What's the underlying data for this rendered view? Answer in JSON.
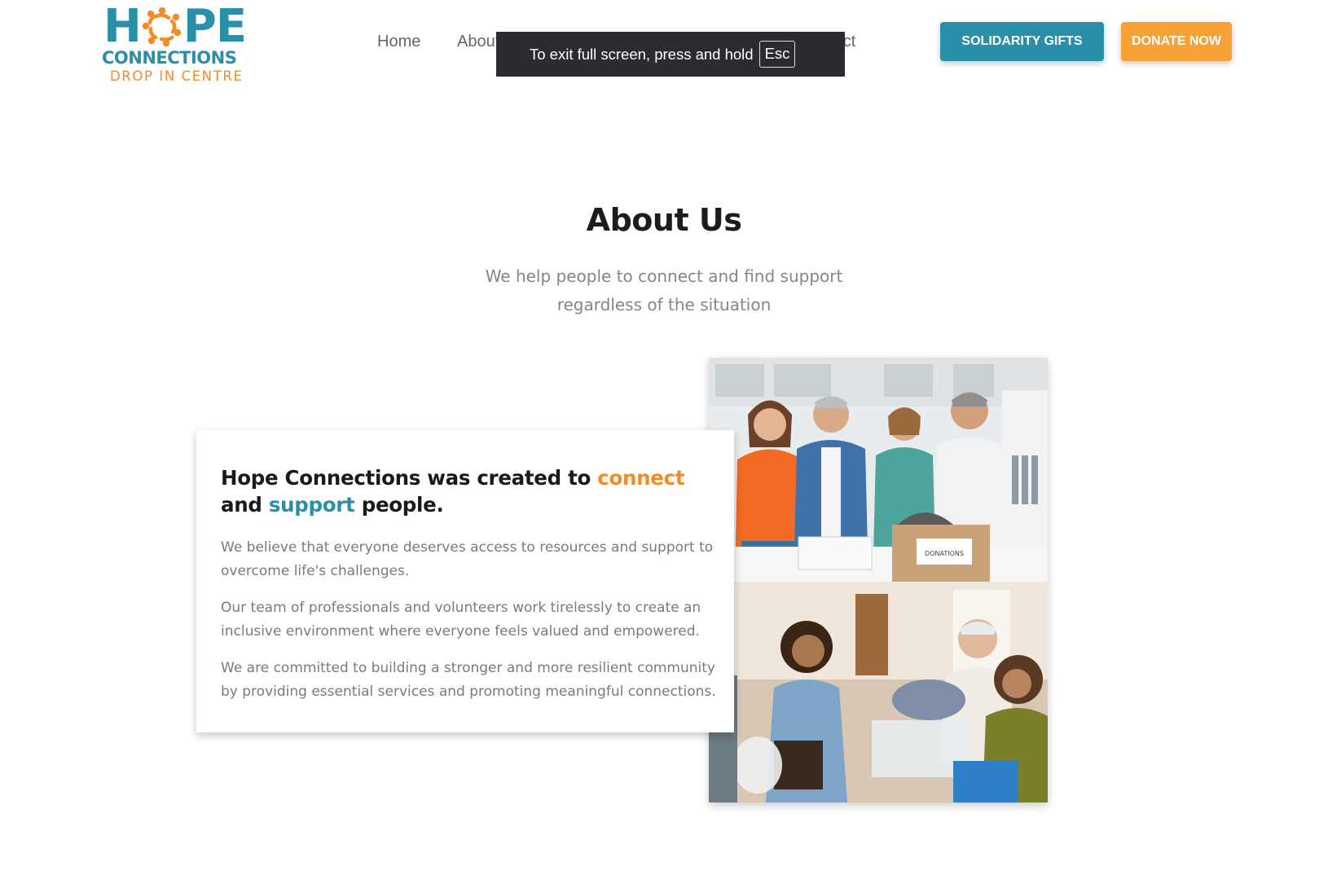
{
  "header": {
    "logo": {
      "hope_h": "H",
      "hope_pe": "PE",
      "connections": "CONNECTIONS",
      "drop_in": "DROP IN CENTRE"
    },
    "nav": {
      "home": "Home",
      "about": "About",
      "contact": "ntact"
    },
    "solidarity_label": "SOLIDARITY GIFTS",
    "donate_label": "DONATE NOW"
  },
  "fullscreen_notice": {
    "text": "To exit full screen, press and hold",
    "key": "Esc"
  },
  "about": {
    "title": "About Us",
    "subtitle": "We help people to connect and find support regardless of the situation",
    "heading": {
      "part1": "Hope Connections was created to ",
      "connect": "connect",
      "part2": " and ",
      "support": "support",
      "part3": " people."
    },
    "paragraphs": [
      "We believe that everyone deserves access to resources and support to overcome life's challenges.",
      "Our team of professionals and volunteers work tirelessly to create an inclusive environment where everyone feels valued and empowered.",
      "We are committed to building a stronger and more resilient community by providing essential services and promoting meaningful connections."
    ],
    "photo_top_box_label": "DONATIONS"
  },
  "colors": {
    "teal": "#2a8fa8",
    "orange": "#f28c28",
    "donate_orange": "#f7a035",
    "toast_bg": "#2b2b31"
  }
}
